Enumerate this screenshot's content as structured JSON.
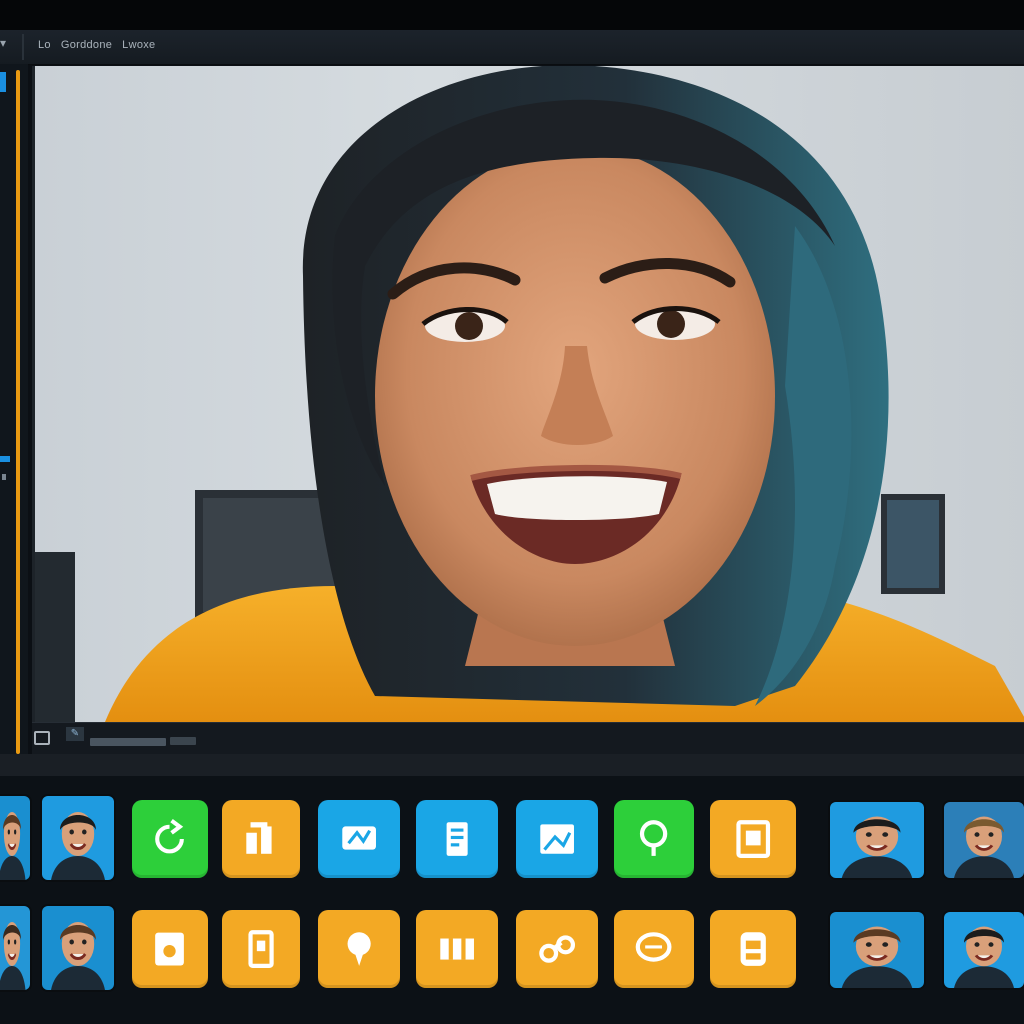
{
  "menubar": {
    "items": [
      "Lo",
      "Gorddone",
      "Lwoxe"
    ]
  },
  "colors": {
    "green": "#2dcf3a",
    "orange": "#f3a924",
    "blue": "#1aa6e6",
    "rail_accent": "#e99a12"
  },
  "tray": {
    "row1": [
      {
        "kind": "thumb",
        "name": "face-thumb"
      },
      {
        "kind": "thumb",
        "name": "face-thumb"
      },
      {
        "kind": "app",
        "color": "green",
        "icon": "refresh-icon"
      },
      {
        "kind": "app",
        "color": "orange",
        "icon": "bars-icon"
      },
      {
        "kind": "app",
        "color": "blue",
        "icon": "badge-icon"
      },
      {
        "kind": "app",
        "color": "blue",
        "icon": "document-icon"
      },
      {
        "kind": "app",
        "color": "blue",
        "icon": "photo-icon"
      },
      {
        "kind": "app",
        "color": "green",
        "icon": "pin-icon"
      },
      {
        "kind": "app",
        "color": "orange",
        "icon": "frame-icon"
      },
      {
        "kind": "thumb",
        "name": "face-thumb"
      },
      {
        "kind": "thumb",
        "name": "face-thumb"
      }
    ],
    "row2": [
      {
        "kind": "thumb",
        "name": "face-thumb"
      },
      {
        "kind": "thumb",
        "name": "face-thumb"
      },
      {
        "kind": "app",
        "color": "orange",
        "icon": "gallery-icon"
      },
      {
        "kind": "app",
        "color": "orange",
        "icon": "note-icon"
      },
      {
        "kind": "app",
        "color": "orange",
        "icon": "chat-icon"
      },
      {
        "kind": "app",
        "color": "orange",
        "icon": "film-icon"
      },
      {
        "kind": "app",
        "color": "orange",
        "icon": "link-icon"
      },
      {
        "kind": "app",
        "color": "orange",
        "icon": "message-icon"
      },
      {
        "kind": "app",
        "color": "orange",
        "icon": "save-icon"
      },
      {
        "kind": "thumb",
        "name": "face-thumb"
      },
      {
        "kind": "thumb",
        "name": "face-thumb"
      }
    ]
  }
}
